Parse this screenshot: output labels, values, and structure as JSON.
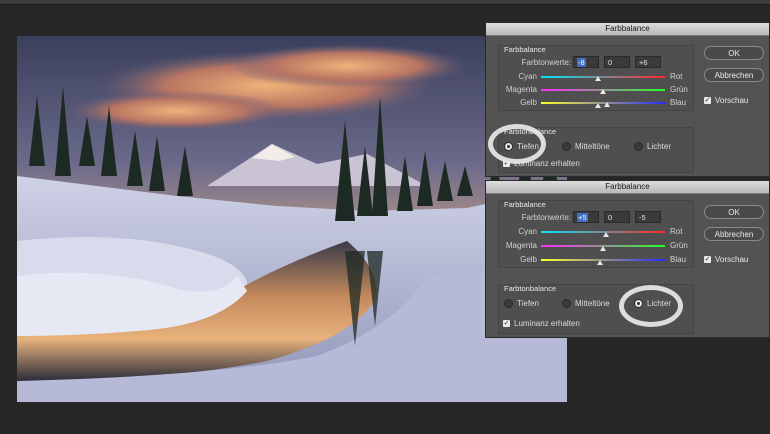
{
  "dialogs": [
    {
      "title": "Farbbalance",
      "balance_legend": "Farbbalance",
      "values_label": "Farbtonwerte:",
      "values": [
        "-8",
        "0",
        "+6"
      ],
      "selected_value_index": 0,
      "sliders": [
        {
          "left": "Cyan",
          "right": "Rot",
          "level": -8
        },
        {
          "left": "Magenta",
          "right": "Grün",
          "level": 0
        },
        {
          "left": "Gelb",
          "right": "Blau",
          "level": 6
        }
      ],
      "tone_legend": "Farbtonbalance",
      "tones": [
        "Tiefen",
        "Mitteltöne",
        "Lichter"
      ],
      "selected_tone": "Tiefen",
      "preserve_luminosity": "Luminanz erhalten",
      "ok": "OK",
      "cancel": "Abbrechen",
      "preview": "Vorschau"
    },
    {
      "title": "Farbbalance",
      "balance_legend": "Farbbalance",
      "values_label": "Farbtonwerte:",
      "values": [
        "+5",
        "0",
        "-5"
      ],
      "selected_value_index": 0,
      "sliders": [
        {
          "left": "Cyan",
          "right": "Rot",
          "level": 5
        },
        {
          "left": "Magenta",
          "right": "Grün",
          "level": 0
        },
        {
          "left": "Gelb",
          "right": "Blau",
          "level": -5
        }
      ],
      "tone_legend": "Farbtonbalance",
      "tones": [
        "Tiefen",
        "Mitteltöne",
        "Lichter"
      ],
      "selected_tone": "Lichter",
      "preserve_luminosity": "Luminanz erhalten",
      "ok": "OK",
      "cancel": "Abbrechen",
      "preview": "Vorschau"
    }
  ],
  "colors": {
    "panel": "#535353",
    "canvas_bg": "#262626",
    "selection_blue": "#3f6ec7",
    "highlight_ring": "#e8e8e8"
  },
  "icons": {
    "checkbox": "check-icon"
  }
}
